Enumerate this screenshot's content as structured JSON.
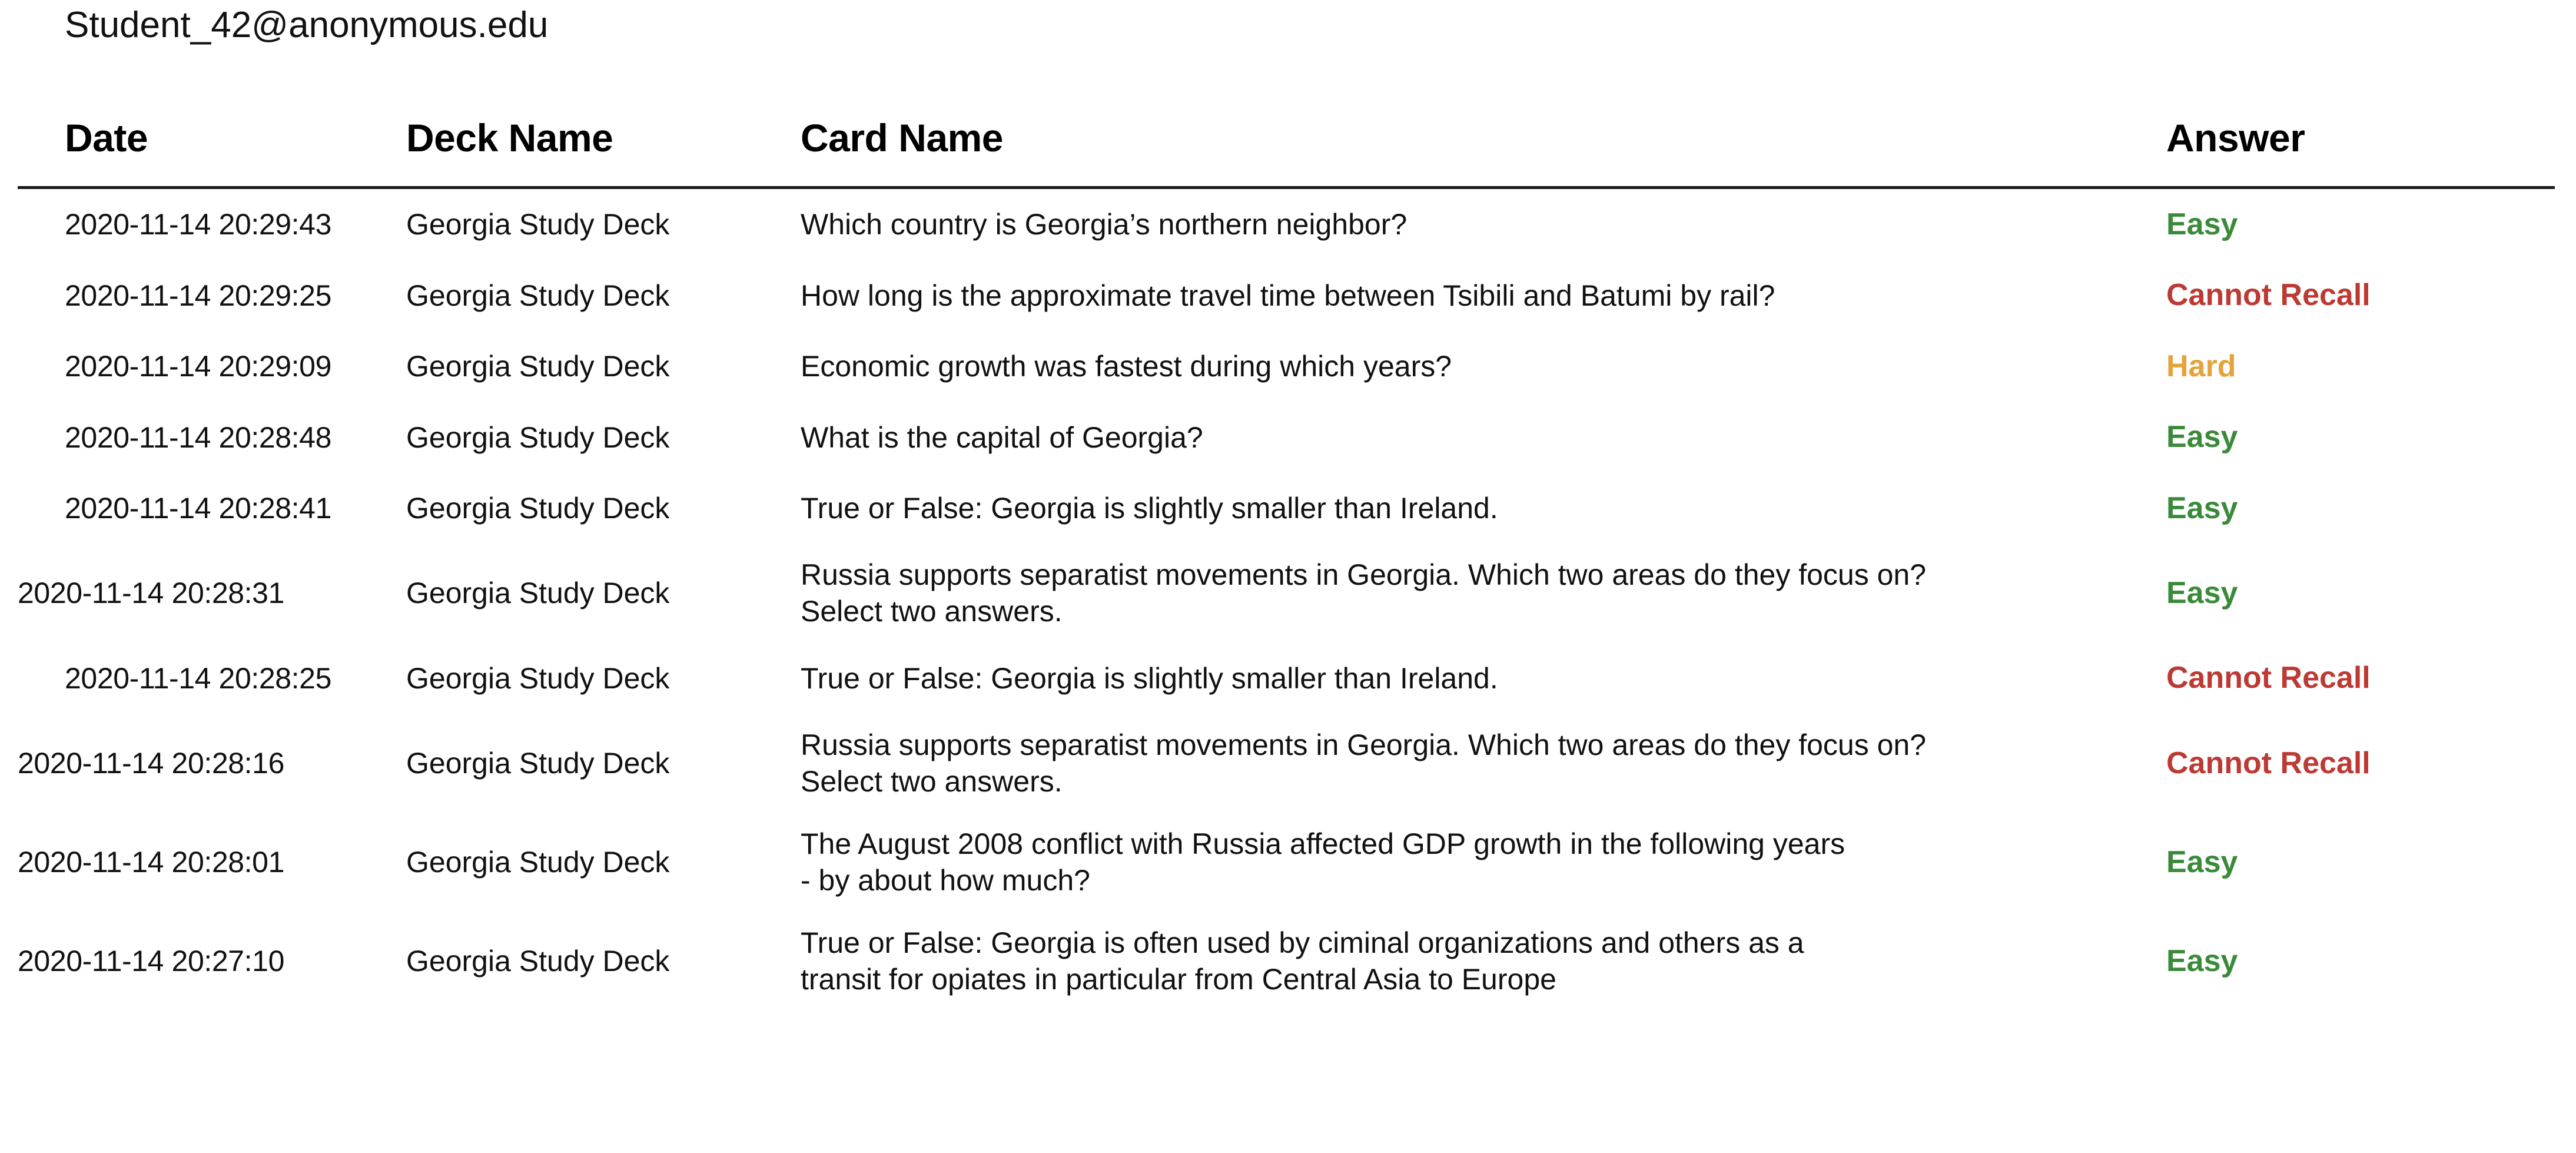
{
  "account": {
    "email": "Student_42@anonymous.edu"
  },
  "table": {
    "columns": {
      "date": "Date",
      "deck": "Deck Name",
      "card": "Card Name",
      "answer": "Answer"
    },
    "answer_colors": {
      "Easy": "#3a8a3a",
      "Hard": "#e5a33c",
      "Cannot Recall": "#bc3a33"
    },
    "rows": [
      {
        "date": "2020-11-14 20:29:43",
        "deck": "Georgia Study Deck",
        "card": "Which country is Georgia’s northern neighbor?",
        "answer": "Easy"
      },
      {
        "date": "2020-11-14 20:29:25",
        "deck": "Georgia Study Deck",
        "card": "How long is the approximate travel time between Tsibili and Batumi by rail?",
        "answer": "Cannot Recall"
      },
      {
        "date": "2020-11-14 20:29:09",
        "deck": "Georgia Study Deck",
        "card": "Economic growth was fastest during which years?",
        "answer": "Hard"
      },
      {
        "date": "2020-11-14 20:28:48",
        "deck": "Georgia Study Deck",
        "card": "What is the capital of Georgia?",
        "answer": "Easy"
      },
      {
        "date": "2020-11-14 20:28:41",
        "deck": "Georgia Study Deck",
        "card": "True or False: Georgia is slightly smaller than Ireland.",
        "answer": "Easy"
      },
      {
        "date": "2020-11-14 20:28:31",
        "deck": "Georgia Study Deck",
        "card": "Russia supports separatist movements in Georgia. Which two areas do they focus on?\nSelect two answers.",
        "answer": "Easy"
      },
      {
        "date": "2020-11-14 20:28:25",
        "deck": "Georgia Study Deck",
        "card": "True or False: Georgia is slightly smaller than Ireland.",
        "answer": "Cannot Recall"
      },
      {
        "date": "2020-11-14 20:28:16",
        "deck": "Georgia Study Deck",
        "card": "Russia supports separatist movements in Georgia. Which two areas do they focus on?\nSelect two answers.",
        "answer": "Cannot Recall"
      },
      {
        "date": "2020-11-14 20:28:01",
        "deck": "Georgia Study Deck",
        "card": "The August 2008 conflict with Russia affected GDP growth in the following years\n- by about how much?",
        "answer": "Easy"
      },
      {
        "date": "2020-11-14 20:27:10",
        "deck": "Georgia Study Deck",
        "card": "True or False: Georgia is often used by ciminal organizations and others as a\ntransit for opiates in particular from Central Asia to Europe",
        "answer": "Easy"
      }
    ]
  }
}
